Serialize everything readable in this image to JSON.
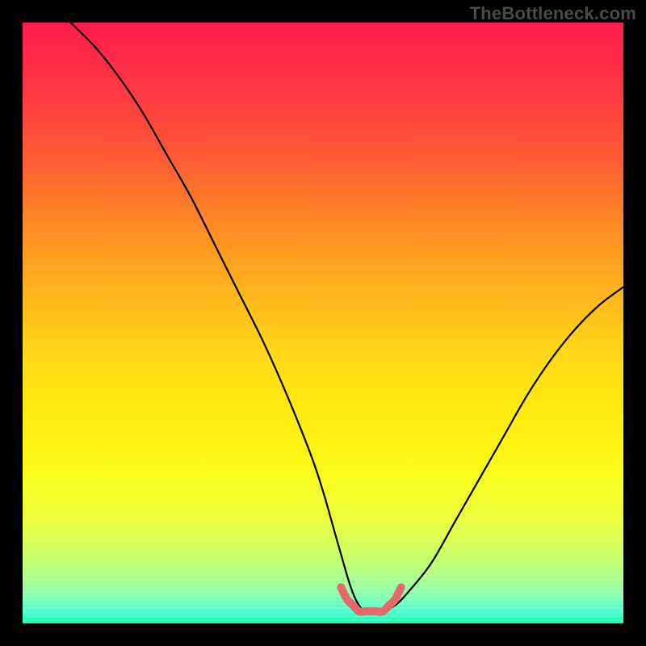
{
  "watermark": "TheBottleneck.com",
  "chart_data": {
    "type": "line",
    "title": "",
    "xlabel": "",
    "ylabel": "",
    "xlim": [
      0,
      100
    ],
    "ylim": [
      0,
      100
    ],
    "grid": false,
    "legend": false,
    "annotations": [],
    "series": [
      {
        "name": "bottleneck-curve",
        "color": "#000000",
        "x": [
          8,
          12,
          16,
          20,
          24,
          28,
          32,
          36,
          40,
          44,
          48,
          50,
          52,
          54,
          55,
          56,
          57,
          58,
          59,
          60,
          62,
          64,
          68,
          72,
          76,
          80,
          84,
          88,
          92,
          96,
          100
        ],
        "values": [
          100,
          96,
          91,
          85,
          78,
          71,
          63,
          55,
          47,
          38,
          28,
          22,
          15,
          8,
          5,
          3,
          2,
          2,
          2,
          2,
          3,
          5,
          10,
          17,
          24,
          31,
          38,
          44,
          49,
          53,
          56
        ]
      },
      {
        "name": "optimal-region",
        "color": "#e26a6a",
        "x": [
          53,
          54,
          55,
          56,
          57,
          58,
          59,
          60,
          61,
          62,
          63
        ],
        "values": [
          6,
          4,
          3,
          2,
          2,
          2,
          2,
          2,
          3,
          4,
          6
        ]
      }
    ],
    "background_gradient": {
      "top": "#ff1a4b",
      "mid": "#ffe713",
      "bottom": "#18ffab"
    }
  }
}
